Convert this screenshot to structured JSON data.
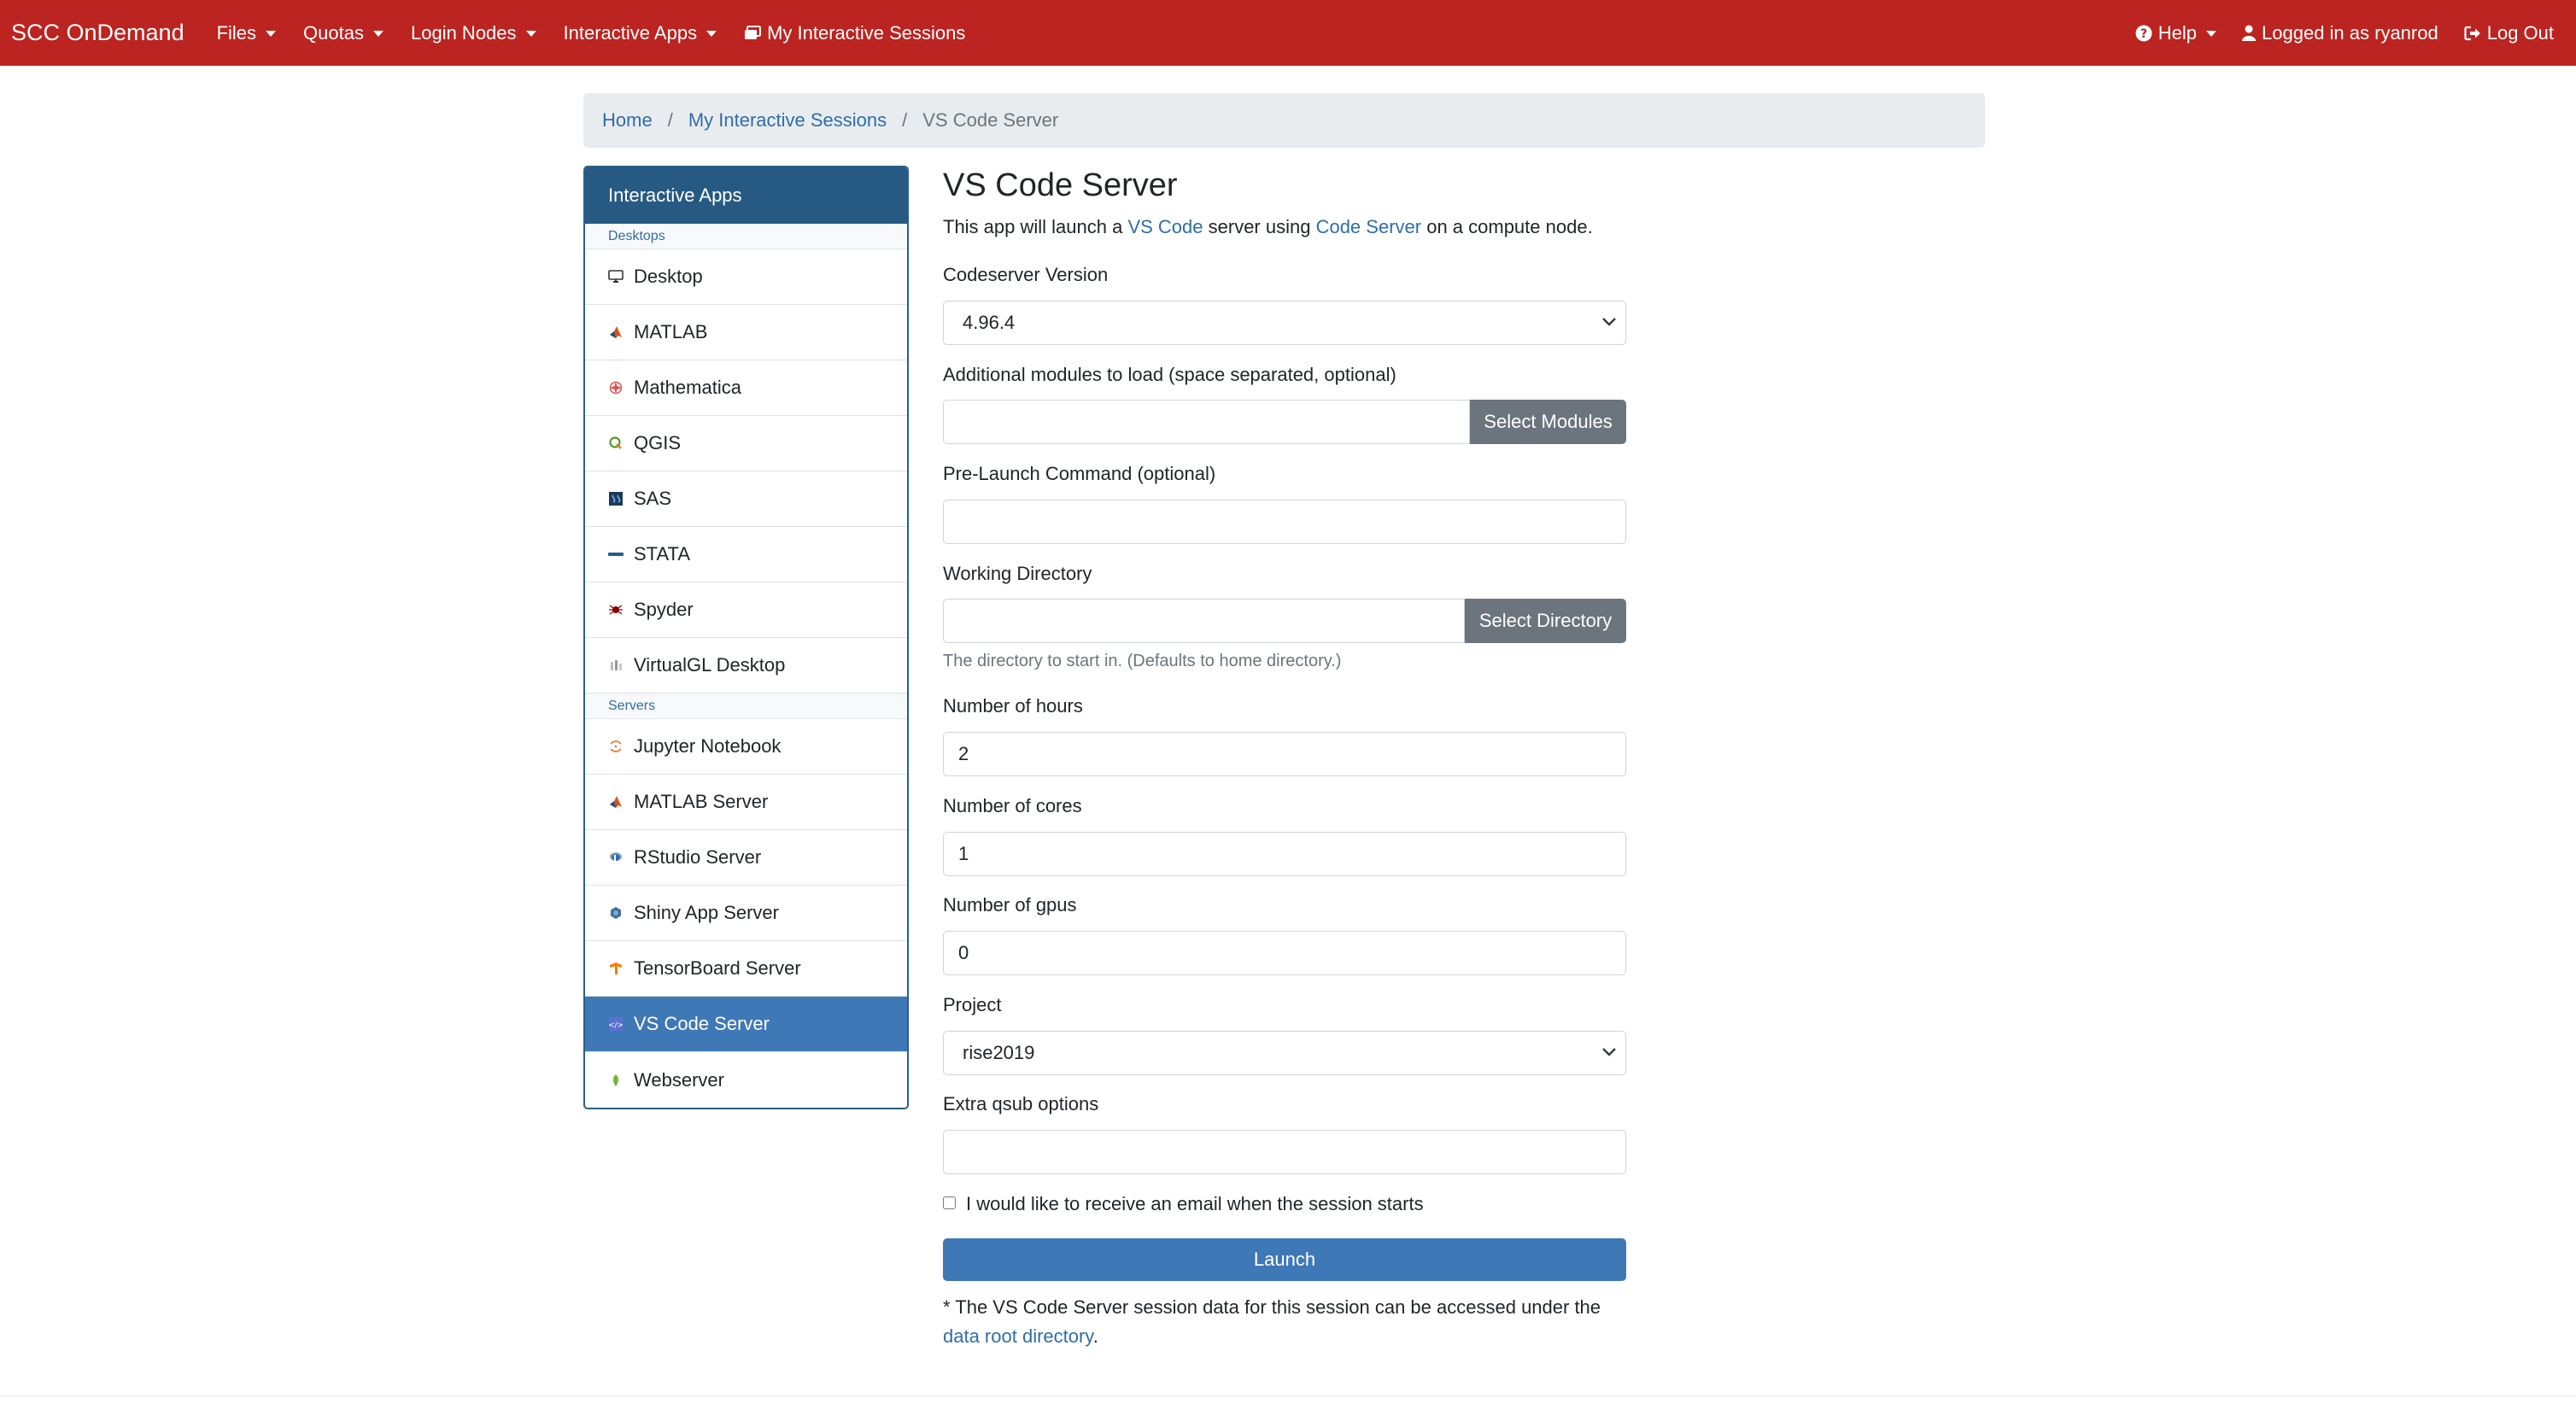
{
  "navbar": {
    "brand": "SCC OnDemand",
    "menus": [
      {
        "label": "Files"
      },
      {
        "label": "Quotas"
      },
      {
        "label": "Login Nodes"
      },
      {
        "label": "Interactive Apps"
      }
    ],
    "sessions_label": "My Interactive Sessions",
    "help_label": "Help",
    "user_label": "Logged in as ryanrod",
    "logout_label": "Log Out",
    "color": "#bb2420"
  },
  "breadcrumb": {
    "home": "Home",
    "sessions": "My Interactive Sessions",
    "current": "VS Code Server"
  },
  "sidebar": {
    "header": "Interactive Apps",
    "desktops_label": "Desktops",
    "desktops": [
      {
        "label": "Desktop",
        "icon": "monitor-icon"
      },
      {
        "label": "MATLAB",
        "icon": "matlab-icon"
      },
      {
        "label": "Mathematica",
        "icon": "mathematica-icon"
      },
      {
        "label": "QGIS",
        "icon": "qgis-icon"
      },
      {
        "label": "SAS",
        "icon": "sas-icon"
      },
      {
        "label": "STATA",
        "icon": "stata-icon"
      },
      {
        "label": "Spyder",
        "icon": "spyder-icon"
      },
      {
        "label": "VirtualGL Desktop",
        "icon": "virtualgl-icon"
      }
    ],
    "servers_label": "Servers",
    "servers": [
      {
        "label": "Jupyter Notebook",
        "icon": "jupyter-icon"
      },
      {
        "label": "MATLAB Server",
        "icon": "matlab-icon"
      },
      {
        "label": "RStudio Server",
        "icon": "rstudio-icon"
      },
      {
        "label": "Shiny App Server",
        "icon": "shiny-icon"
      },
      {
        "label": "TensorBoard Server",
        "icon": "tensorboard-icon"
      },
      {
        "label": "VS Code Server",
        "icon": "vscode-icon",
        "active": true
      },
      {
        "label": "Webserver",
        "icon": "webserver-icon"
      }
    ],
    "active_color": "#3f78b7"
  },
  "form": {
    "title": "VS Code Server",
    "desc": {
      "part1": "This app will launch a ",
      "link1": "VS Code",
      "part2": " server using ",
      "link2": "Code Server",
      "part3": " on a compute node."
    },
    "version_label": "Codeserver Version",
    "version_value": "4.96.4",
    "modules_label": "Additional modules to load (space separated, optional)",
    "modules_value": "",
    "modules_button": "Select Modules",
    "prelaunch_label": "Pre-Launch Command (optional)",
    "prelaunch_value": "",
    "workdir_label": "Working Directory",
    "workdir_value": "",
    "workdir_button": "Select Directory",
    "workdir_help": "The directory to start in. (Defaults to home directory.)",
    "hours_label": "Number of hours",
    "hours_value": "2",
    "cores_label": "Number of cores",
    "cores_value": "1",
    "gpus_label": "Number of gpus",
    "gpus_value": "0",
    "project_label": "Project",
    "project_value": "rise2019",
    "qsub_label": "Extra qsub options",
    "qsub_value": "",
    "email_label": "I would like to receive an email when the session starts",
    "email_checked": false,
    "launch_label": "Launch",
    "note_part1": "* The VS Code Server session data for this session can be accessed under the",
    "note_link": "data root directory",
    "note_end": "."
  }
}
